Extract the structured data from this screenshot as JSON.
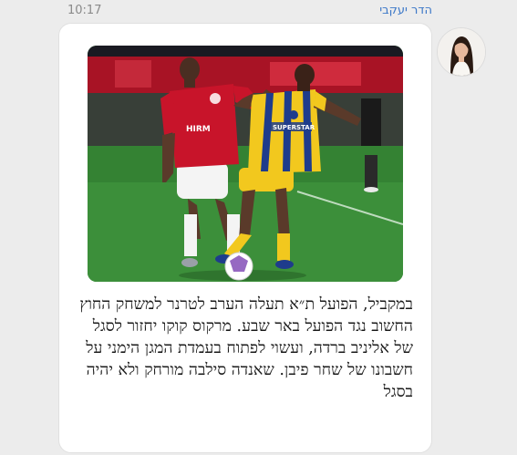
{
  "message": {
    "sender_name": "הדר יעקבי",
    "time": "10:17",
    "caption": "במקביל, הפועל ת״א תעלה הערב לטרנר למשחק החוץ החשוב נגד הפועל באר שבע. מרקוס קוקו יחזור לסגל של אליניב ברדה, ועשוי לפתוח בעמדת המגן הימני על חשבונו של שחר פיבן. שאנדה סילבה מורחק ולא יהיה בסגל"
  },
  "photo": {
    "player_left_shirt": "HIRM",
    "player_right_shirt": "SUPERSTAR"
  },
  "colors": {
    "sender": "#3c78c8",
    "time": "#8a8a8a",
    "bubble": "#ffffff",
    "background": "#ececec",
    "pitch": "#3a8a3a",
    "red_kit": "#c8142a",
    "yellow_kit": "#f2c81e",
    "blue_trim": "#1e3c8c"
  }
}
